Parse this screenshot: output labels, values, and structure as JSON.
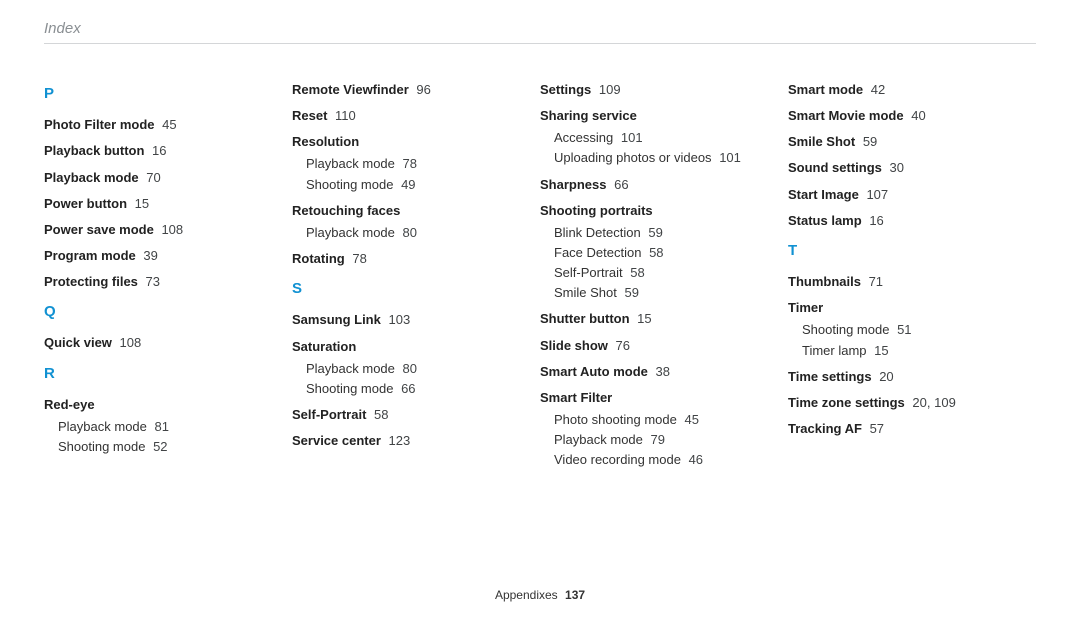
{
  "header": "Index",
  "footer": {
    "section": "Appendixes",
    "page": "137"
  },
  "columns": [
    [
      {
        "type": "letter",
        "text": "P"
      },
      {
        "type": "topic",
        "label": "Photo Filter mode",
        "pages": "45"
      },
      {
        "type": "topic",
        "label": "Playback button",
        "pages": "16"
      },
      {
        "type": "topic",
        "label": "Playback mode",
        "pages": "70"
      },
      {
        "type": "topic",
        "label": "Power button",
        "pages": "15"
      },
      {
        "type": "topic",
        "label": "Power save mode",
        "pages": "108"
      },
      {
        "type": "topic",
        "label": "Program mode",
        "pages": "39"
      },
      {
        "type": "topic",
        "label": "Protecting files",
        "pages": "73"
      },
      {
        "type": "letter",
        "text": "Q"
      },
      {
        "type": "topic",
        "label": "Quick view",
        "pages": "108"
      },
      {
        "type": "letter",
        "text": "R"
      },
      {
        "type": "topic",
        "label": "Red-eye",
        "subs": [
          {
            "label": "Playback mode",
            "pages": "81"
          },
          {
            "label": "Shooting mode",
            "pages": "52"
          }
        ]
      }
    ],
    [
      {
        "type": "topic",
        "label": "Remote Viewfinder",
        "pages": "96"
      },
      {
        "type": "topic",
        "label": "Reset",
        "pages": "110"
      },
      {
        "type": "topic",
        "label": "Resolution",
        "subs": [
          {
            "label": "Playback mode",
            "pages": "78"
          },
          {
            "label": "Shooting mode",
            "pages": "49"
          }
        ]
      },
      {
        "type": "topic",
        "label": "Retouching faces",
        "subs": [
          {
            "label": "Playback mode",
            "pages": "80"
          }
        ]
      },
      {
        "type": "topic",
        "label": "Rotating",
        "pages": "78"
      },
      {
        "type": "letter",
        "text": "S"
      },
      {
        "type": "topic",
        "label": "Samsung Link",
        "pages": "103"
      },
      {
        "type": "topic",
        "label": "Saturation",
        "subs": [
          {
            "label": "Playback mode",
            "pages": "80"
          },
          {
            "label": "Shooting mode",
            "pages": "66"
          }
        ]
      },
      {
        "type": "topic",
        "label": "Self-Portrait",
        "pages": "58"
      },
      {
        "type": "topic",
        "label": "Service center",
        "pages": "123"
      }
    ],
    [
      {
        "type": "topic",
        "label": "Settings",
        "pages": "109"
      },
      {
        "type": "topic",
        "label": "Sharing service",
        "subs": [
          {
            "label": "Accessing",
            "pages": "101"
          },
          {
            "label": "Uploading photos or videos",
            "pages": "101"
          }
        ]
      },
      {
        "type": "topic",
        "label": "Sharpness",
        "pages": "66"
      },
      {
        "type": "topic",
        "label": "Shooting portraits",
        "subs": [
          {
            "label": "Blink Detection",
            "pages": "59"
          },
          {
            "label": "Face Detection",
            "pages": "58"
          },
          {
            "label": "Self-Portrait",
            "pages": "58"
          },
          {
            "label": "Smile Shot",
            "pages": "59"
          }
        ]
      },
      {
        "type": "topic",
        "label": "Shutter button",
        "pages": "15"
      },
      {
        "type": "topic",
        "label": "Slide show",
        "pages": "76"
      },
      {
        "type": "topic",
        "label": "Smart Auto mode",
        "pages": "38"
      },
      {
        "type": "topic",
        "label": "Smart Filter",
        "subs": [
          {
            "label": "Photo shooting mode",
            "pages": "45"
          },
          {
            "label": "Playback mode",
            "pages": "79"
          },
          {
            "label": "Video recording mode",
            "pages": "46"
          }
        ]
      }
    ],
    [
      {
        "type": "topic",
        "label": "Smart mode",
        "pages": "42"
      },
      {
        "type": "topic",
        "label": "Smart Movie mode",
        "pages": "40"
      },
      {
        "type": "topic",
        "label": "Smile Shot",
        "pages": "59"
      },
      {
        "type": "topic",
        "label": "Sound settings",
        "pages": "30"
      },
      {
        "type": "topic",
        "label": "Start Image",
        "pages": "107"
      },
      {
        "type": "topic",
        "label": "Status lamp",
        "pages": "16"
      },
      {
        "type": "letter",
        "text": "T"
      },
      {
        "type": "topic",
        "label": "Thumbnails",
        "pages": "71"
      },
      {
        "type": "topic",
        "label": "Timer",
        "subs": [
          {
            "label": "Shooting mode",
            "pages": "51"
          },
          {
            "label": "Timer lamp",
            "pages": "15"
          }
        ]
      },
      {
        "type": "topic",
        "label": "Time settings",
        "pages": "20"
      },
      {
        "type": "topic",
        "label": "Time zone settings",
        "pages": "20, 109"
      },
      {
        "type": "topic",
        "label": "Tracking AF",
        "pages": "57"
      }
    ]
  ]
}
